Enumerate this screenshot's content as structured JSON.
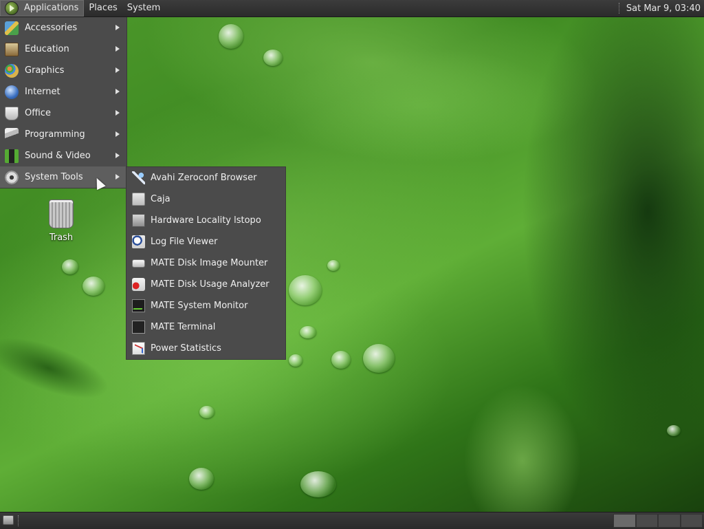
{
  "top_panel": {
    "menus": [
      "Applications",
      "Places",
      "System"
    ],
    "clock": "Sat Mar  9, 03:40"
  },
  "apps_menu": {
    "items": [
      {
        "label": "Accessories",
        "icon": "accessories-icon"
      },
      {
        "label": "Education",
        "icon": "education-icon"
      },
      {
        "label": "Graphics",
        "icon": "graphics-icon"
      },
      {
        "label": "Internet",
        "icon": "internet-icon"
      },
      {
        "label": "Office",
        "icon": "office-icon"
      },
      {
        "label": "Programming",
        "icon": "programming-icon"
      },
      {
        "label": "Sound & Video",
        "icon": "sound-video-icon"
      },
      {
        "label": "System Tools",
        "icon": "system-tools-icon"
      }
    ],
    "active_item": "System Tools"
  },
  "system_tools_submenu": {
    "items": [
      {
        "label": "Avahi Zeroconf Browser",
        "icon": "avahi-icon"
      },
      {
        "label": "Caja",
        "icon": "caja-icon"
      },
      {
        "label": "Hardware Locality lstopo",
        "icon": "hwloc-icon"
      },
      {
        "label": "Log File Viewer",
        "icon": "log-viewer-icon"
      },
      {
        "label": "MATE Disk Image Mounter",
        "icon": "disk-mounter-icon"
      },
      {
        "label": "MATE Disk Usage Analyzer",
        "icon": "disk-usage-icon"
      },
      {
        "label": "MATE System Monitor",
        "icon": "system-monitor-icon"
      },
      {
        "label": "MATE Terminal",
        "icon": "terminal-icon"
      },
      {
        "label": "Power Statistics",
        "icon": "power-stats-icon"
      }
    ]
  },
  "desktop": {
    "icons": [
      {
        "label": "Trash",
        "icon": "trash-icon"
      }
    ]
  }
}
